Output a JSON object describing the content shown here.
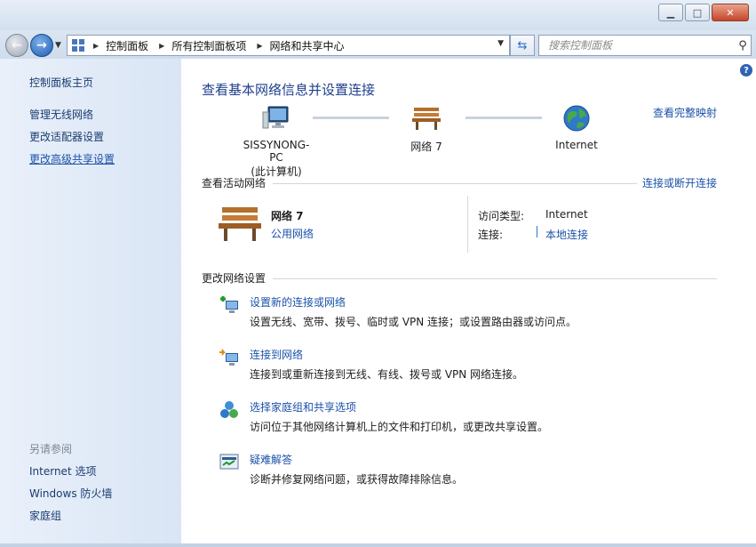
{
  "window": {
    "minimize": "▁",
    "maximize": "□",
    "close": "✕"
  },
  "address": {
    "crumbs": [
      "控制面板",
      "所有控制面板项",
      "网络和共享中心"
    ],
    "search_placeholder": "搜索控制面板"
  },
  "sidebar": {
    "home": "控制面板主页",
    "links": [
      "管理无线网络",
      "更改适配器设置",
      "更改高级共享设置"
    ],
    "see_also_title": "另请参阅",
    "see_also": [
      "Internet 选项",
      "Windows 防火墙",
      "家庭组"
    ]
  },
  "main": {
    "title": "查看基本网络信息并设置连接",
    "view_full_map": "查看完整映射",
    "map": {
      "computer_name": "SISSYNONG-PC",
      "computer_sub": "(此计算机)",
      "network_name": "网络  7",
      "internet": "Internet"
    },
    "active": {
      "heading": "查看活动网络",
      "connect_link": "连接或断开连接",
      "network_name": "网络  7",
      "network_type": "公用网络",
      "access_label": "访问类型:",
      "access_value": "Internet",
      "conn_label": "连接:",
      "conn_value": "本地连接"
    },
    "change": {
      "heading": "更改网络设置",
      "tasks": [
        {
          "link": "设置新的连接或网络",
          "desc": "设置无线、宽带、拨号、临时或 VPN 连接；或设置路由器或访问点。"
        },
        {
          "link": "连接到网络",
          "desc": "连接到或重新连接到无线、有线、拨号或 VPN 网络连接。"
        },
        {
          "link": "选择家庭组和共享选项",
          "desc": "访问位于其他网络计算机上的文件和打印机，或更改共享设置。"
        },
        {
          "link": "疑难解答",
          "desc": "诊断并修复网络问题，或获得故障排除信息。"
        }
      ]
    }
  }
}
